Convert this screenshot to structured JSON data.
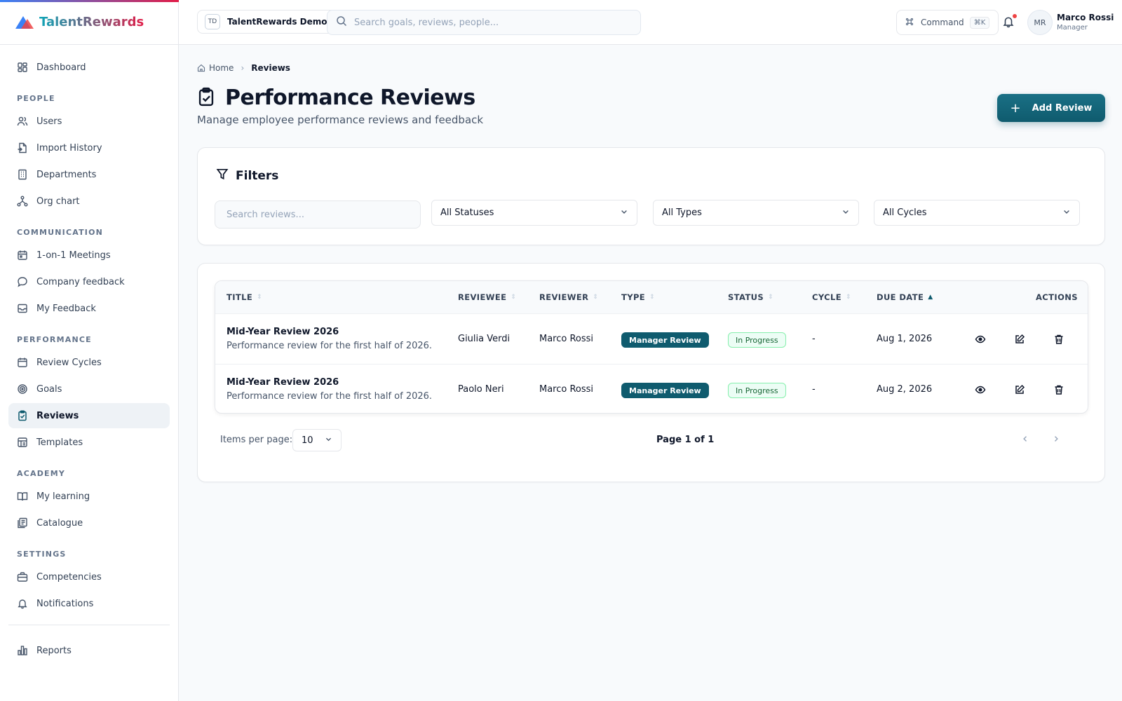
{
  "brand": {
    "name": "TalentRewards"
  },
  "header": {
    "org_badge": "TD",
    "org_name": "TalentRewards Demo",
    "search_placeholder": "Search goals, reviews, people...",
    "command_label": "Command",
    "command_shortcut": "⌘K",
    "user_initials": "MR",
    "user_name": "Marco Rossi",
    "user_role": "Manager"
  },
  "sidebar": {
    "dashboard": "Dashboard",
    "sections": {
      "people": "PEOPLE",
      "communication": "COMMUNICATION",
      "performance": "PERFORMANCE",
      "academy": "ACADEMY",
      "settings": "SETTINGS"
    },
    "people_items": [
      "Users",
      "Import History",
      "Departments",
      "Org chart"
    ],
    "communication_items": [
      "1-on-1 Meetings",
      "Company feedback",
      "My Feedback"
    ],
    "performance_items": [
      "Review Cycles",
      "Goals",
      "Reviews",
      "Templates"
    ],
    "academy_items": [
      "My learning",
      "Catalogue"
    ],
    "settings_items": [
      "Competencies",
      "Notifications"
    ],
    "reports": "Reports"
  },
  "breadcrumb": {
    "home": "Home",
    "current": "Reviews"
  },
  "page": {
    "title": "Performance Reviews",
    "subtitle": "Manage employee performance reviews and feedback",
    "add_button": "Add Review"
  },
  "filters": {
    "title": "Filters",
    "search_placeholder": "Search reviews...",
    "status": "All Statuses",
    "type": "All Types",
    "cycle": "All Cycles"
  },
  "table": {
    "columns": [
      "TITLE",
      "REVIEWEE",
      "REVIEWER",
      "TYPE",
      "STATUS",
      "CYCLE",
      "DUE DATE",
      "ACTIONS"
    ],
    "rows": [
      {
        "title": "Mid-Year Review 2026",
        "description": "Performance review for the first half of 2026.",
        "reviewee": "Giulia Verdi",
        "reviewer": "Marco Rossi",
        "type": "Manager Review",
        "status": "In Progress",
        "cycle": "-",
        "due_date": "Aug 1, 2026"
      },
      {
        "title": "Mid-Year Review 2026",
        "description": "Performance review for the first half of 2026.",
        "reviewee": "Paolo Neri",
        "reviewer": "Marco Rossi",
        "type": "Manager Review",
        "status": "In Progress",
        "cycle": "-",
        "due_date": "Aug 2, 2026"
      }
    ]
  },
  "pagination": {
    "items_per_page_label": "Items per page:",
    "items_per_page": "10",
    "page_info": "Page 1 of 1"
  },
  "colors": {
    "accent": "#0f5b6e",
    "status_green": "#166534",
    "notification_dot": "#ef4444"
  }
}
